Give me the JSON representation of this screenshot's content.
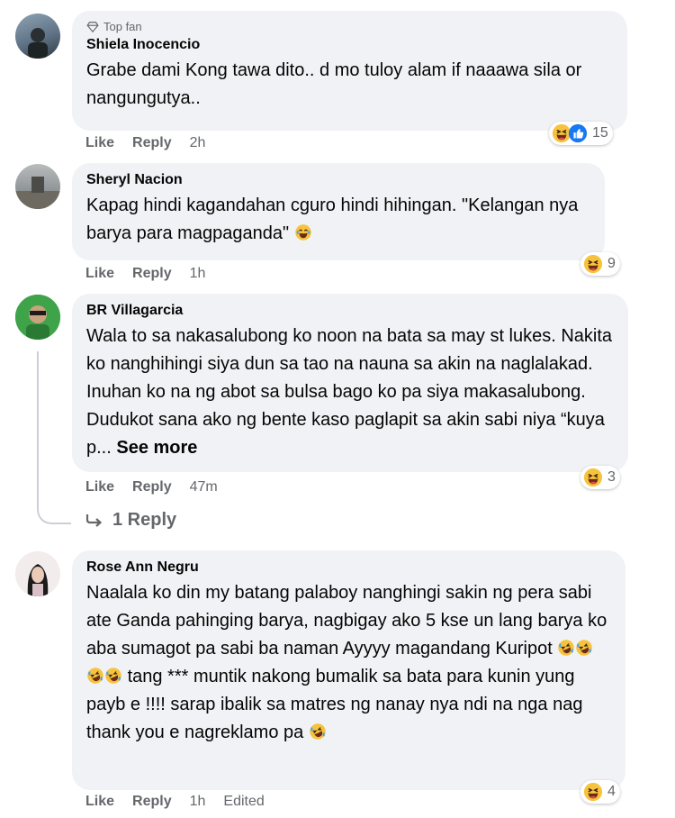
{
  "comments": [
    {
      "author": "Shiela Inocencio",
      "badge": "Top fan",
      "text": "Grabe dami Kong tawa dito.. d mo tuloy alam if naaawa sila or nangungutya..",
      "like": "Like",
      "reply": "Reply",
      "time": "2h",
      "reaction_count": "15"
    },
    {
      "author": "Sheryl Nacion",
      "text": "Kapag hindi kagandahan cguro hindi hihingan. \"Kelangan nya barya para magpaganda\"",
      "like": "Like",
      "reply": "Reply",
      "time": "1h",
      "reaction_count": "9"
    },
    {
      "author": "BR Villagarcia",
      "text": "Wala to sa nakasalubong ko noon na bata sa may st lukes. Nakita ko nanghihingi siya dun sa tao na nauna sa akin na naglalakad. Inuhan ko na ng abot sa bulsa bago ko pa siya makasalubong. Dudukot sana ako ng bente kaso paglapit sa akin sabi niya “kuya p...",
      "see_more": "See more",
      "like": "Like",
      "reply": "Reply",
      "time": "47m",
      "reaction_count": "3",
      "replies_label": "1 Reply"
    },
    {
      "author": "Rose Ann Negru",
      "text_part1": "Naalala ko din my batang palaboy nanghingi sakin ng pera sabi ate Ganda pahinging barya, nagbigay ako 5 kse un lang barya ko aba sumagot pa sabi ba naman Ayyyy magandang Kuripot",
      "text_part2": "tang *** muntik nakong bumalik sa bata para kunin yung payb e !!!! sarap ibalik sa matres ng nanay nya ndi na nga nag thank you e nagreklamo pa",
      "like": "Like",
      "reply": "Reply",
      "time": "1h",
      "edited": "Edited",
      "reaction_count": "4"
    }
  ],
  "icons": {
    "haha": "haha-reaction-icon",
    "like": "like-reaction-icon",
    "rofl": "rofl-emoji-icon",
    "laugh": "laughing-emoji-icon",
    "badge": "top-fan-badge-icon",
    "reply_arrow": "reply-arrow-icon"
  },
  "colors": {
    "bubble": "#f0f2f5",
    "meta": "#65676b",
    "like_blue": "#1877f2",
    "haha_yellow": "#f7c33d"
  }
}
